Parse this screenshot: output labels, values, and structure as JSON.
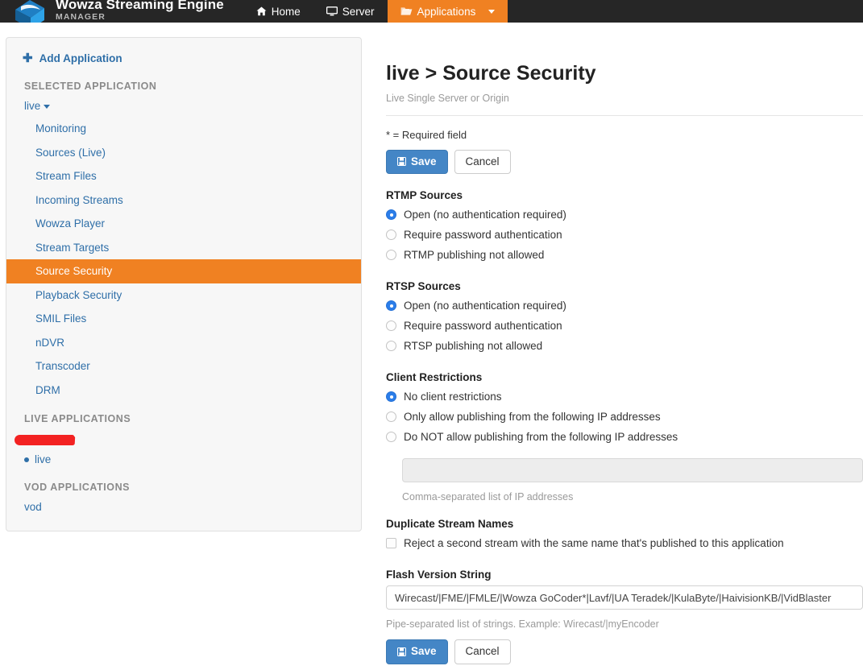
{
  "topnav": {
    "brand_title": "Wowza Streaming Engine",
    "brand_subtitle": "MANAGER",
    "logo_icon": "wowza-logo-icon",
    "items": [
      {
        "label": "Home",
        "icon": "home-icon",
        "active": false
      },
      {
        "label": "Server",
        "icon": "monitor-icon",
        "active": false
      },
      {
        "label": "Applications",
        "icon": "folder-icon",
        "active": true,
        "caret": true
      }
    ]
  },
  "sidebar": {
    "add_application": "Add Application",
    "add_icon": "plus-icon",
    "selected_application_heading": "SELECTED APPLICATION",
    "selected_application": "live",
    "items": [
      {
        "label": "Monitoring",
        "selected": false
      },
      {
        "label": "Sources (Live)",
        "selected": false
      },
      {
        "label": "Stream Files",
        "selected": false
      },
      {
        "label": "Incoming Streams",
        "selected": false
      },
      {
        "label": "Wowza Player",
        "selected": false
      },
      {
        "label": "Stream Targets",
        "selected": false
      },
      {
        "label": "Source Security",
        "selected": true
      },
      {
        "label": "Playback Security",
        "selected": false
      },
      {
        "label": "SMIL Files",
        "selected": false
      },
      {
        "label": "nDVR",
        "selected": false
      },
      {
        "label": "Transcoder",
        "selected": false
      },
      {
        "label": "DRM",
        "selected": false
      }
    ],
    "live_applications_heading": "LIVE APPLICATIONS",
    "live_applications": [
      {
        "label": "live",
        "running": true
      }
    ],
    "vod_applications_heading": "VOD APPLICATIONS",
    "vod_applications": [
      {
        "label": "vod"
      }
    ]
  },
  "main": {
    "title": "live > Source Security",
    "subtitle": "Live Single Server or Origin",
    "required_note": "* = Required field",
    "save_label": "Save",
    "save_icon": "floppy-disk-icon",
    "cancel_label": "Cancel",
    "rtmp": {
      "title": "RTMP Sources",
      "options": [
        {
          "label": "Open (no authentication required)",
          "checked": true
        },
        {
          "label": "Require password authentication",
          "checked": false
        },
        {
          "label": "RTMP publishing not allowed",
          "checked": false
        }
      ]
    },
    "rtsp": {
      "title": "RTSP Sources",
      "options": [
        {
          "label": "Open (no authentication required)",
          "checked": true
        },
        {
          "label": "Require password authentication",
          "checked": false
        },
        {
          "label": "RTSP publishing not allowed",
          "checked": false
        }
      ]
    },
    "client_restrictions": {
      "title": "Client Restrictions",
      "options": [
        {
          "label": "No client restrictions",
          "checked": true
        },
        {
          "label": "Only allow publishing from the following IP addresses",
          "checked": false
        },
        {
          "label": "Do NOT allow publishing from the following IP addresses",
          "checked": false
        }
      ],
      "ip_value": "",
      "ip_help": "Comma-separated list of IP addresses"
    },
    "duplicate_stream_names": {
      "title": "Duplicate Stream Names",
      "checkbox_label": "Reject a second stream with the same name that's published to this application",
      "checked": false
    },
    "flash_version_string": {
      "title": "Flash Version String",
      "value": "Wirecast/|FME/|FMLE/|Wowza GoCoder*|Lavf/|UA Teradek/|KulaByte/|HaivisionKB/|VidBlaster",
      "help": "Pipe-separated list of strings. Example: Wirecast/|myEncoder"
    },
    "bottom_save_label": "Save",
    "bottom_cancel_label": "Cancel"
  },
  "colors": {
    "nav_bg": "#262626",
    "accent_orange": "#f08122",
    "link_blue": "#2f6fa8",
    "button_blue": "#4486c6",
    "radio_blue": "#2b7de9",
    "redaction_red": "#f32222"
  }
}
